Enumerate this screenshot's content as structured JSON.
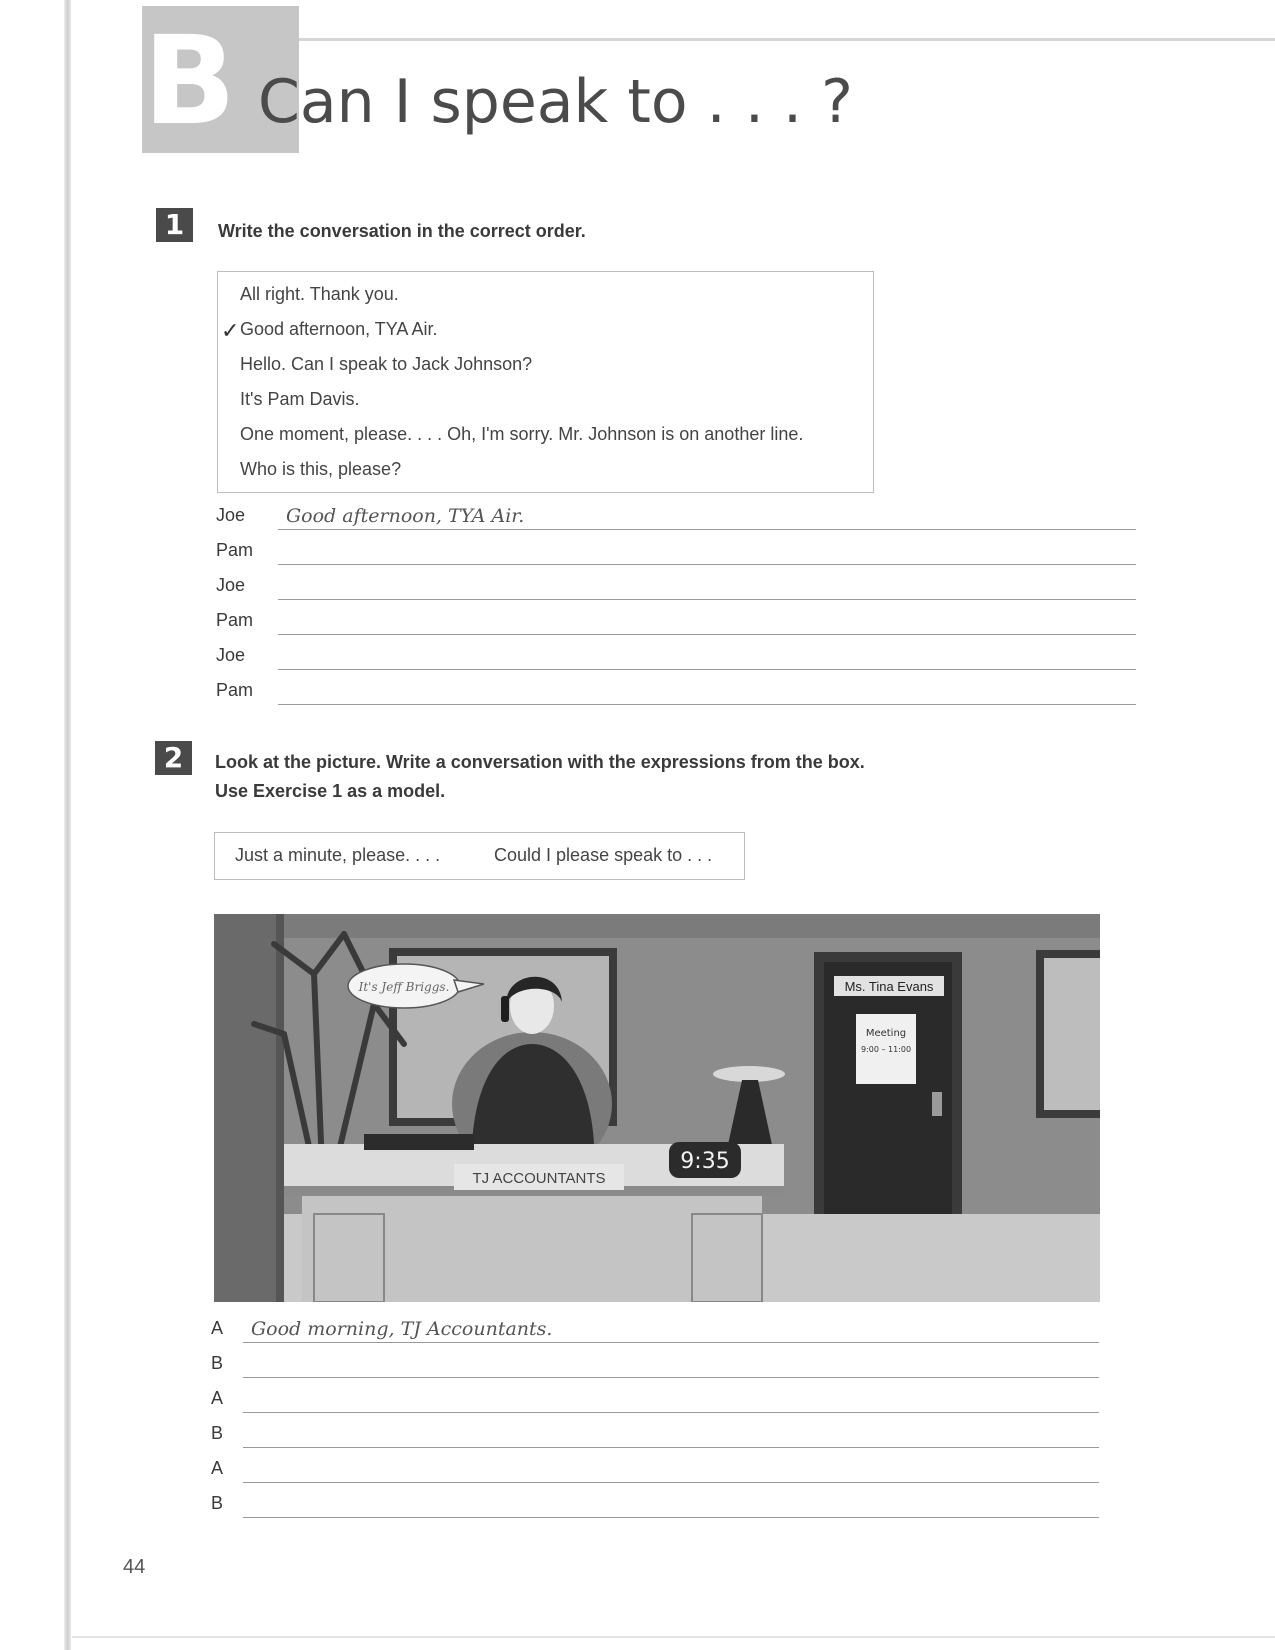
{
  "header": {
    "unit_letter": "B",
    "title": "Can I speak to . . . ?"
  },
  "exercise1": {
    "number": "1",
    "instruction": "Write the conversation in the correct order.",
    "box_lines": [
      "All right. Thank you.",
      "Good afternoon, TYA Air.",
      "Hello. Can I speak to Jack Johnson?",
      "It's Pam Davis.",
      "One moment, please. . . . Oh, I'm sorry. Mr. Johnson is on another line.",
      "Who is this, please?"
    ],
    "checked_mark": "✓",
    "rows": [
      {
        "speaker": "Joe",
        "answer": "Good afternoon, TYA Air."
      },
      {
        "speaker": "Pam",
        "answer": ""
      },
      {
        "speaker": "Joe",
        "answer": ""
      },
      {
        "speaker": "Pam",
        "answer": ""
      },
      {
        "speaker": "Joe",
        "answer": ""
      },
      {
        "speaker": "Pam",
        "answer": ""
      }
    ]
  },
  "exercise2": {
    "number": "2",
    "instruction_line1": "Look at the picture. Write a conversation with the expressions from the box.",
    "instruction_line2": "Use Exercise 1 as a model.",
    "box_items": [
      "Just a minute, please. . . .",
      "Could I please speak to . . ."
    ],
    "picture": {
      "speech_bubble": "It's Jeff Briggs.",
      "door_sign": "Ms. Tina Evans",
      "note_title": "Meeting",
      "note_time": "9:00 – 11:00",
      "clock": "9:35",
      "desk_sign": "TJ ACCOUNTANTS"
    },
    "rows": [
      {
        "speaker": "A",
        "answer": "Good morning, TJ Accountants."
      },
      {
        "speaker": "B",
        "answer": ""
      },
      {
        "speaker": "A",
        "answer": ""
      },
      {
        "speaker": "B",
        "answer": ""
      },
      {
        "speaker": "A",
        "answer": ""
      },
      {
        "speaker": "B",
        "answer": ""
      }
    ]
  },
  "page_number": "44"
}
